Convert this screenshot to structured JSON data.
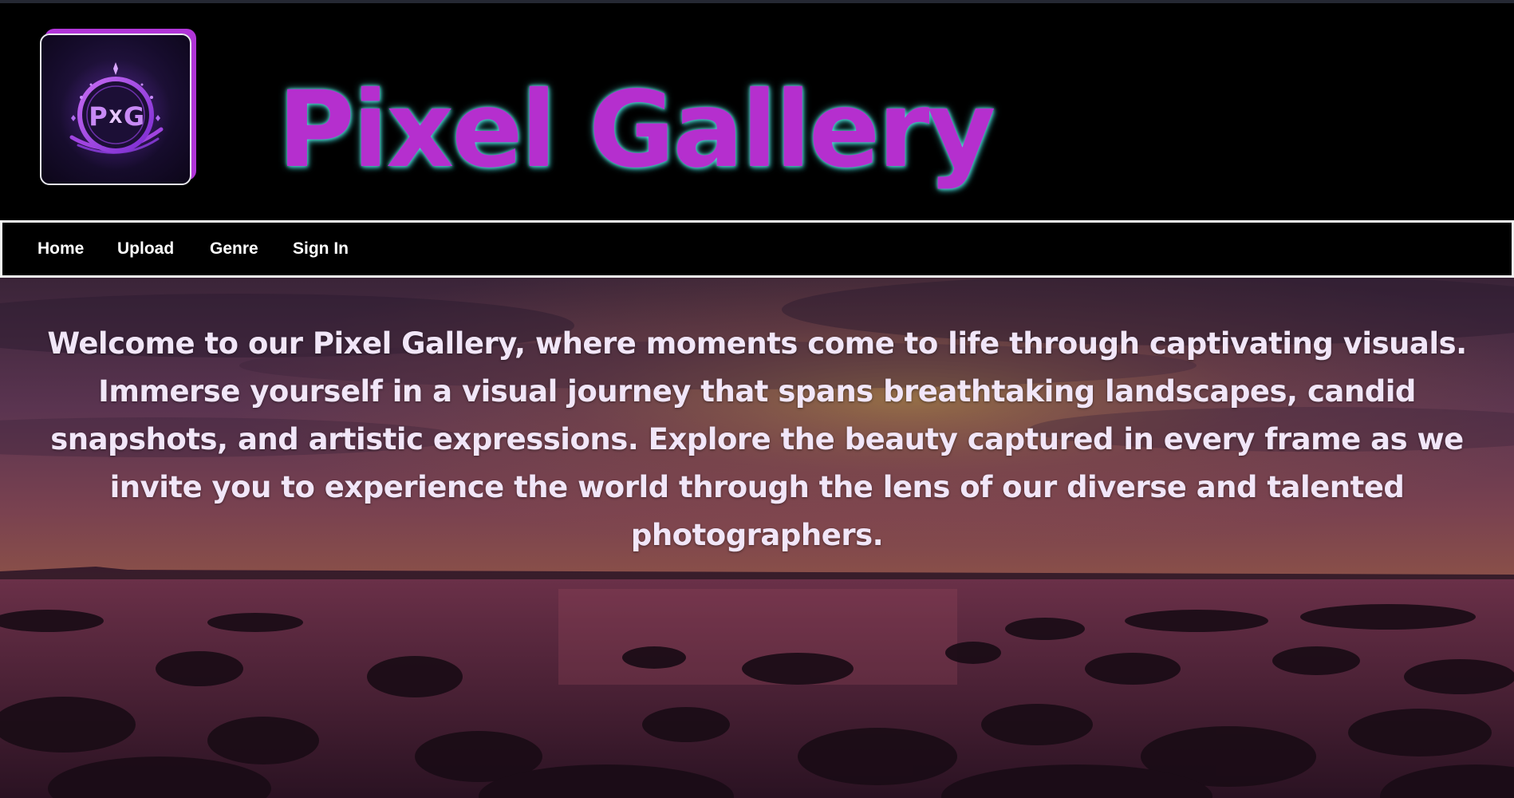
{
  "header": {
    "logo": {
      "monogram_left": "P",
      "monogram_right": "G",
      "monogram_center": "X",
      "icon": "pixel-gallery-logo-icon"
    },
    "title": "Pixel Gallery"
  },
  "nav": {
    "items": [
      {
        "label": "Home"
      },
      {
        "label": "Upload"
      },
      {
        "label": "Genre"
      },
      {
        "label": "Sign In"
      }
    ]
  },
  "hero": {
    "background": "sunset-rocky-shore-image",
    "paragraph": "Welcome to our Pixel Gallery, where moments come to life through captivating visuals. Immerse yourself in a visual journey that spans breathtaking landscapes, candid snapshots, and artistic expressions. Explore the beauty captured in every frame as we invite you to experience the world through the lens of our diverse and talented photographers."
  },
  "colors": {
    "title_fill": "#b52fce",
    "title_glow": "#57e6df",
    "logo_accent": "#b135d8",
    "nav_border": "#f2f2f2",
    "page_background": "#000000"
  }
}
